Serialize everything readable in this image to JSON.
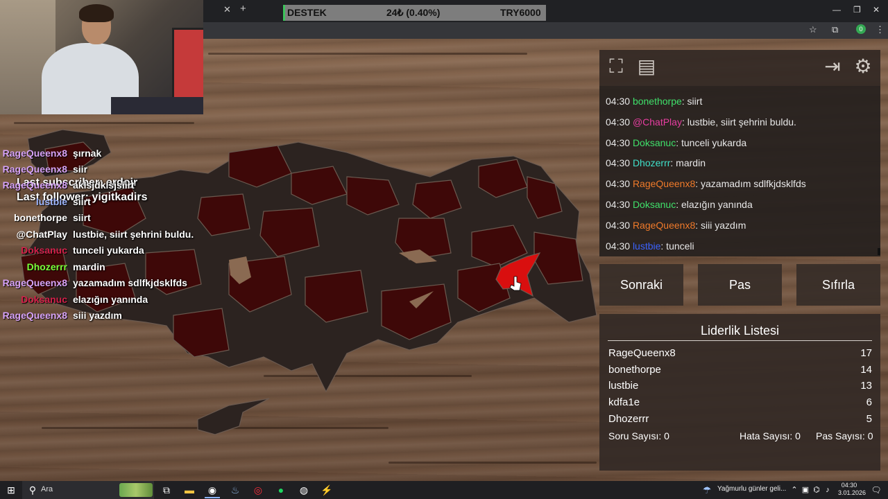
{
  "donation_bar": {
    "left": "DESTEK",
    "amount": "24₺ (0.40%)",
    "goal": "TRY6000"
  },
  "stream_overlay": {
    "last_subscriber": "Last subscriber: erdojr",
    "last_follower": "Last follower: yigitkadirs"
  },
  "stream_chat": [
    {
      "name": "RageQueenx8",
      "msg": "şırnak",
      "color": "#d7a3f7"
    },
    {
      "name": "RageQueenx8",
      "msg": "siir",
      "color": "#d7a3f7"
    },
    {
      "name": "RageQueenx8",
      "msg": "aklsjdklsjsiirt",
      "color": "#d7a3f7"
    },
    {
      "name": "lustbie",
      "msg": "siirt",
      "color": "#9fb7ff"
    },
    {
      "name": "bonethorpe",
      "msg": "siirt",
      "color": "#ffffff"
    },
    {
      "name": "@ChatPlay",
      "msg": "lustbie, siirt şehrini buldu.",
      "color": "#ffffff"
    },
    {
      "name": "Doksanuc",
      "msg": "tunceli yukarda",
      "color": "#d4204a"
    },
    {
      "name": "Dhozerrr",
      "msg": "mardin",
      "color": "#7bff3a"
    },
    {
      "name": "RageQueenx8",
      "msg": "yazamadım sdlfkjdsklfds",
      "color": "#d7a3f7"
    },
    {
      "name": "Doksanuc",
      "msg": "elazığın yanında",
      "color": "#d4204a"
    },
    {
      "name": "RageQueenx8",
      "msg": "siii yazdım",
      "color": "#d7a3f7"
    }
  ],
  "game_chat": [
    {
      "time": "04:30",
      "name": "bonethorpe",
      "msg": ": siirt",
      "color": "#3fe06a"
    },
    {
      "time": "04:30",
      "name": "@ChatPlay",
      "msg": ": lustbie, siirt şehrini buldu.",
      "color": "#e83ea1"
    },
    {
      "time": "04:30",
      "name": "Doksanuc",
      "msg": ": tunceli yukarda",
      "color": "#3fe06a"
    },
    {
      "time": "04:30",
      "name": "Dhozerrr",
      "msg": ": mardin",
      "color": "#3fe0c9"
    },
    {
      "time": "04:30",
      "name": "RageQueenx8",
      "msg": ": yazamadım sdlfkjdsklfds",
      "color": "#f07a2a"
    },
    {
      "time": "04:30",
      "name": "Doksanuc",
      "msg": ": elazığın yanında",
      "color": "#3fe06a"
    },
    {
      "time": "04:30",
      "name": "RageQueenx8",
      "msg": ": siii yazdım",
      "color": "#f07a2a"
    },
    {
      "time": "04:30",
      "name": "lustbie",
      "msg": ": tunceli",
      "color": "#3b63ff"
    }
  ],
  "buttons": {
    "next": "Sonraki",
    "pass": "Pas",
    "reset": "Sıfırla"
  },
  "leaderboard": {
    "title": "Liderlik Listesi",
    "rows": [
      {
        "name": "RageQueenx8",
        "score": "17"
      },
      {
        "name": "bonethorpe",
        "score": "14"
      },
      {
        "name": "lustbie",
        "score": "13"
      },
      {
        "name": "kdfa1e",
        "score": "6"
      },
      {
        "name": "Dhozerrr",
        "score": "5"
      }
    ],
    "question_count": "Soru Sayısı: 0",
    "error_count": "Hata Sayısı: 0",
    "pass_count": "Pas Sayısı: 0"
  },
  "taskbar": {
    "search_placeholder": "Ara",
    "weather": "Yağmurlu günler geli...",
    "time": "04:30",
    "date": "3.01.2026"
  },
  "colors": {
    "province_dark": "#2c2320",
    "province_red": "#3e0808",
    "province_highlight": "#d90f0f",
    "stroke": "#6b5a50"
  }
}
